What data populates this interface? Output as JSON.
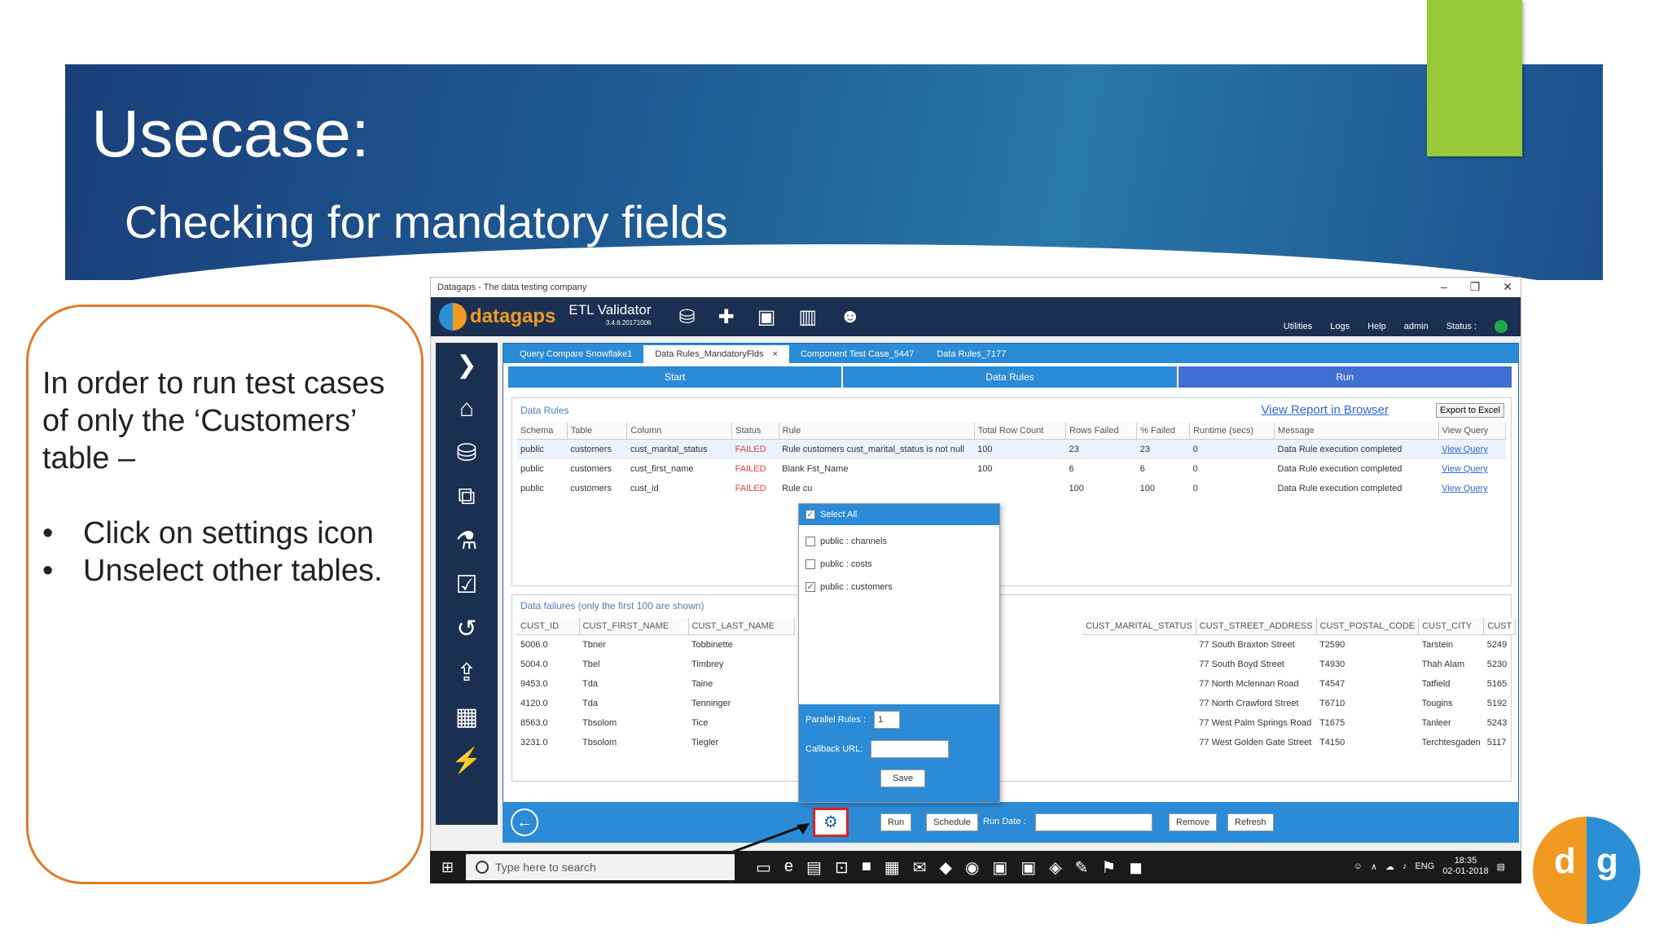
{
  "slide": {
    "title": "Usecase:",
    "subtitle": "Checking for mandatory fields",
    "callout_text": "In order to run test cases of only the ‘Customers’ table –",
    "callout_bullets": [
      "Click on settings icon",
      "Unselect other tables."
    ]
  },
  "app": {
    "window_title": "Datagaps - The data testing company",
    "logo_brand": "datagaps",
    "product_name": "ETL Validator",
    "version": "3.4.6.20171006",
    "header_links": [
      "Utilities",
      "Logs",
      "Help",
      "admin",
      "Status :"
    ],
    "tabs": [
      "Query Compare Snowflake1",
      "Data Rules_MandatoryFlds",
      "Component Test Case_5447",
      "Data Rules_7177"
    ],
    "tab_close": "×",
    "steps": [
      "Start",
      "Data Rules",
      "Run"
    ],
    "rules_panel": {
      "label": "Data Rules",
      "report_link": "View Report in Browser",
      "excel_button": "Export to Excel",
      "columns": [
        "Schema",
        "Table",
        "Column",
        "Status",
        "Rule",
        "Total Row Count",
        "Rows Failed",
        "% Failed",
        "Runtime (secs)",
        "Message",
        "View Query"
      ],
      "rows": [
        [
          "public",
          "customers",
          "cust_marital_status",
          "FAILED",
          "Rule customers cust_marital_status is not null",
          "100",
          "23",
          "23",
          "0",
          "Data Rule execution completed",
          "View Query"
        ],
        [
          "public",
          "customers",
          "cust_first_name",
          "FAILED",
          "Blank Fst_Name",
          "100",
          "6",
          "6",
          "0",
          "Data Rule execution completed",
          "View Query"
        ],
        [
          "public",
          "customers",
          "cust_id",
          "FAILED",
          "Rule cu",
          "",
          "100",
          "100",
          "0",
          "Data Rule execution completed",
          "View Query"
        ]
      ]
    },
    "failures_panel": {
      "label": "Data failures (only the first 100 are shown)",
      "left_columns": [
        "CUST_ID",
        "CUST_FIRST_NAME",
        "CUST_LAST_NAME"
      ],
      "right_columns": [
        "CUST_MARITAL_STATUS",
        "CUST_STREET_ADDRESS",
        "CUST_POSTAL_CODE",
        "CUST_CITY",
        "CUST"
      ],
      "rows": [
        [
          "5006.0",
          "Tbner",
          "Tobbinette",
          "",
          "77 South Braxton Street",
          "T2590",
          "Tarstein",
          "5249"
        ],
        [
          "5004.0",
          "Tbel",
          "Timbrey",
          "",
          "77 South Boyd Street",
          "T4930",
          "Thah Alam",
          "5230"
        ],
        [
          "9453.0",
          "Tda",
          "Taine",
          "",
          "77 North Mclennan Road",
          "T4547",
          "Tatfield",
          "5165"
        ],
        [
          "4120.0",
          "Tda",
          "Tenninger",
          "",
          "77 North Crawford Street",
          "T6710",
          "Tougins",
          "5192"
        ],
        [
          "8563.0",
          "Tbsolom",
          "Tice",
          "",
          "77 West Palm Springs Road",
          "T1675",
          "Tanleer",
          "5243"
        ],
        [
          "3231.0",
          "Tbsolom",
          "Tiegler",
          "",
          "77 West Golden Gate Street",
          "T4150",
          "Terchtesgaden",
          "5117"
        ]
      ]
    },
    "popup": {
      "select_all": "Select All",
      "items": [
        {
          "label": "public : channels",
          "checked": false
        },
        {
          "label": "public : costs",
          "checked": false
        },
        {
          "label": "public : customers",
          "checked": true
        }
      ],
      "parallel_label": "Parallel Rules :",
      "parallel_value": "1",
      "callback_label": "Callback URL:",
      "save_label": "Save"
    },
    "bottom_bar": {
      "run": "Run",
      "schedule": "Schedule",
      "run_date": "Run Date :",
      "remove": "Remove",
      "refresh": "Refresh"
    },
    "taskbar": {
      "search_placeholder": "Type here to search",
      "lang": "ENG",
      "time": "18:35",
      "date": "02-01-2018"
    }
  },
  "colors": {
    "banner": "#1f5d95",
    "accent_green": "#97c93a",
    "callout_border": "#e07b2a",
    "app_blue": "#2b8bd6",
    "failed": "#e04040"
  }
}
